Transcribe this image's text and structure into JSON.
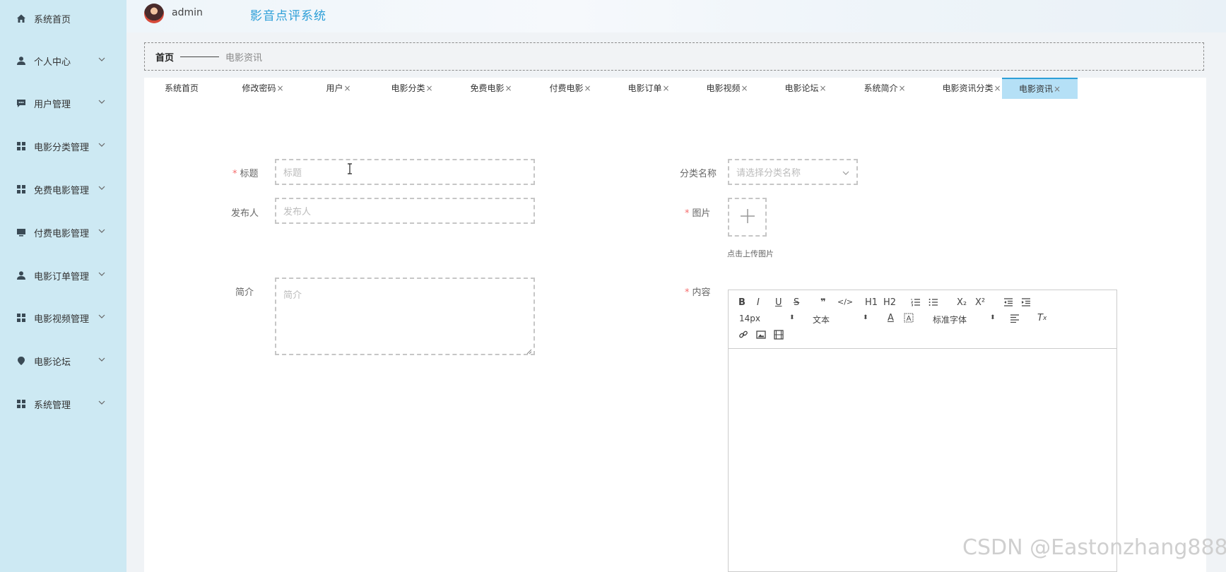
{
  "header": {
    "username": "admin",
    "app_title": "影音点评系统"
  },
  "sidebar": {
    "items": [
      {
        "label": "系统首页",
        "icon": "home-icon",
        "has_submenu": false
      },
      {
        "label": "个人中心",
        "icon": "user-icon",
        "has_submenu": true
      },
      {
        "label": "用户管理",
        "icon": "chat-icon",
        "has_submenu": true
      },
      {
        "label": "电影分类管理",
        "icon": "grid-icon",
        "has_submenu": true
      },
      {
        "label": "免费电影管理",
        "icon": "grid-icon",
        "has_submenu": true
      },
      {
        "label": "付费电影管理",
        "icon": "monitor-icon",
        "has_submenu": true
      },
      {
        "label": "电影订单管理",
        "icon": "user-icon",
        "has_submenu": true
      },
      {
        "label": "电影视频管理",
        "icon": "grid-icon",
        "has_submenu": true
      },
      {
        "label": "电影论坛",
        "icon": "location-icon",
        "has_submenu": true
      },
      {
        "label": "系统管理",
        "icon": "grid-icon",
        "has_submenu": true
      }
    ]
  },
  "breadcrumb": {
    "home": "首页",
    "current": "电影资讯"
  },
  "tabs": [
    {
      "label": "系统首页",
      "closable": false,
      "active": false
    },
    {
      "label": "修改密码",
      "closable": true,
      "active": false
    },
    {
      "label": "用户",
      "closable": true,
      "active": false
    },
    {
      "label": "电影分类",
      "closable": true,
      "active": false
    },
    {
      "label": "免费电影",
      "closable": true,
      "active": false
    },
    {
      "label": "付费电影",
      "closable": true,
      "active": false
    },
    {
      "label": "电影订单",
      "closable": true,
      "active": false
    },
    {
      "label": "电影视频",
      "closable": true,
      "active": false
    },
    {
      "label": "电影论坛",
      "closable": true,
      "active": false
    },
    {
      "label": "系统简介",
      "closable": true,
      "active": false
    },
    {
      "label": "电影资讯分类",
      "closable": true,
      "active": false
    },
    {
      "label": "电影资讯",
      "closable": true,
      "active": true
    }
  ],
  "tab_close_glyph": "×",
  "form": {
    "title": {
      "label": "标题",
      "placeholder": "标题",
      "value": "",
      "required": true
    },
    "publisher": {
      "label": "发布人",
      "placeholder": "发布人",
      "value": ""
    },
    "summary": {
      "label": "简介",
      "placeholder": "简介",
      "value": ""
    },
    "category": {
      "label": "分类名称",
      "placeholder": "请选择分类名称",
      "required": true
    },
    "image": {
      "label": "图片",
      "tip": "点击上传图片",
      "required": true
    },
    "content": {
      "label": "内容",
      "required": true
    },
    "required_mark": "*"
  },
  "editor": {
    "buttons": [
      "B",
      "I",
      "U",
      "S",
      "❞",
      "</>",
      "H1",
      "H2",
      "ordered-list",
      "bullet-list",
      "X₂",
      "X²",
      "outdent",
      "indent"
    ],
    "font_size": "14px",
    "block_type": "文本",
    "font_family": "标准字体"
  },
  "colors": {
    "sidebar_bg": "#cde9f3",
    "accent": "#2d9fd8",
    "active_tab": "#b5e0f6",
    "required": "#f56c6c"
  },
  "watermark": "CSDN @Eastonzhang888"
}
